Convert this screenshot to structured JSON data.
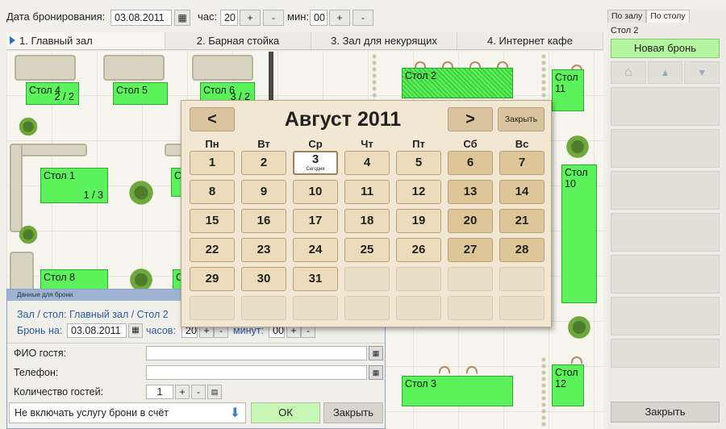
{
  "toolbar": {
    "date_label": "Дата бронирования:",
    "date_value": "03.08.2011",
    "hour_label": "час:",
    "hour_value": "20",
    "minute_label": "мин:",
    "minute_value": "00",
    "plus": "+",
    "minus": "-"
  },
  "tabs": [
    "1. Главный зал",
    "2. Барная стойка",
    "3. Зал для некурящих",
    "4. Интернет кафе"
  ],
  "tables": [
    {
      "name": "Стол 4",
      "count": "2 / 2"
    },
    {
      "name": "Стол 5",
      "count": ""
    },
    {
      "name": "Стол 6",
      "count": "3 / 2"
    },
    {
      "name": "Стол 2",
      "count": ""
    },
    {
      "name": "Стол 11",
      "count": ""
    },
    {
      "name": "Стол 1",
      "count": "1 / 3"
    },
    {
      "name": "Стол 10",
      "count": ""
    },
    {
      "name": "Стол 8",
      "count": ""
    },
    {
      "name": "Ст",
      "count": ""
    },
    {
      "name": "Сто",
      "count": ""
    },
    {
      "name": "Стол 3",
      "count": ""
    },
    {
      "name": "Стол 12",
      "count": ""
    }
  ],
  "side": {
    "tab1": "По залу",
    "tab2": "По столу",
    "table_label": "Стол 2",
    "new_booking": "Новая бронь",
    "close": "Закрыть"
  },
  "calendar": {
    "prev": "<",
    "next": ">",
    "title": "Август 2011",
    "close": "Закрыть",
    "today_caption": "Сегодня",
    "weekdays": [
      "Пн",
      "Вт",
      "Ср",
      "Чт",
      "Пт",
      "Сб",
      "Вс"
    ],
    "days": [
      "1",
      "2",
      "3",
      "4",
      "5",
      "6",
      "7",
      "8",
      "9",
      "10",
      "11",
      "12",
      "13",
      "14",
      "15",
      "16",
      "17",
      "18",
      "19",
      "20",
      "21",
      "22",
      "23",
      "24",
      "25",
      "26",
      "27",
      "28",
      "29",
      "30",
      "31"
    ]
  },
  "dialog": {
    "title": "Данные для брони",
    "hall_table": "Зал / стол: Главный зал / Стол 2",
    "booking_on_label": "Бронь на:",
    "booking_date": "03.08.2011",
    "hours_label": "часов:",
    "hours_value": "20",
    "minutes_label": "минут:",
    "minutes_value": "00",
    "guest_name_label": "ФИО гостя:",
    "phone_label": "Телефон:",
    "guests_label": "Количество гостей:",
    "guests_value": "1",
    "service_option": "Не включать услугу брони в счёт",
    "ok": "ОК",
    "close": "Закрыть"
  }
}
